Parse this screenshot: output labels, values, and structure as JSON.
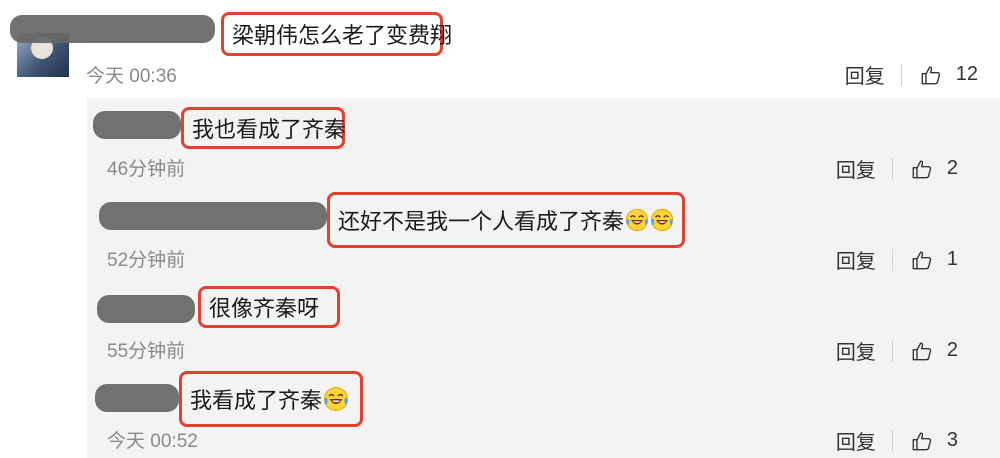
{
  "main_comment": {
    "text": "梁朝伟怎么老了变费翔",
    "time": "今天 00:36",
    "reply_label": "回复",
    "likes": "12"
  },
  "replies": [
    {
      "text": "我也看成了齐秦",
      "emoji_count": 0,
      "time": "46分钟前",
      "reply_label": "回复",
      "likes": "2"
    },
    {
      "text": "还好不是我一个人看成了齐秦",
      "emoji_count": 2,
      "time": "52分钟前",
      "reply_label": "回复",
      "likes": "1"
    },
    {
      "text": "很像齐秦呀",
      "emoji_count": 0,
      "time": "55分钟前",
      "reply_label": "回复",
      "likes": "2"
    },
    {
      "text": "我看成了齐秦",
      "emoji_count": 1,
      "time": "今天 00:52",
      "reply_label": "回复",
      "likes": "3"
    }
  ],
  "icons": {
    "like": "thumbs-up-outline-icon",
    "emoji": "laughing-crying-emoji-icon"
  },
  "colors": {
    "highlight_border": "#e2412f",
    "redaction": "#666666",
    "reply_panel_bg": "#f3f3f3",
    "meta_text": "#8a8a8a"
  }
}
